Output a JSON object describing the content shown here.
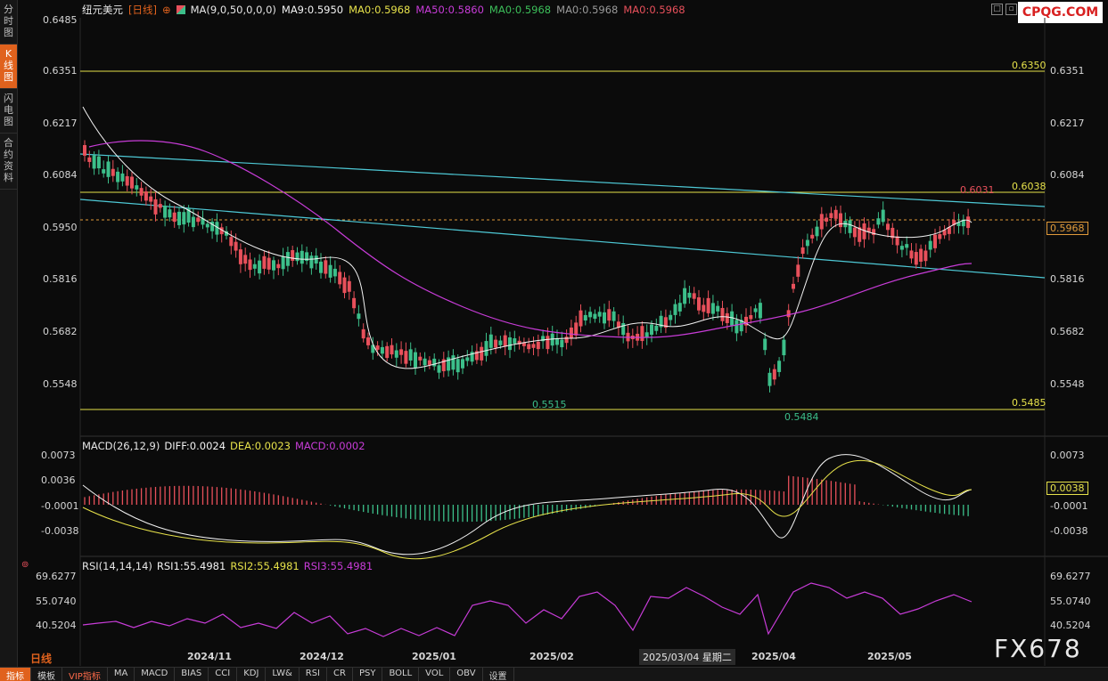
{
  "sidebar": {
    "tabs": [
      {
        "chars": [
          "分",
          "时",
          "图"
        ],
        "active": false
      },
      {
        "chars": [
          "K",
          "线",
          "图"
        ],
        "active": true
      },
      {
        "chars": [
          "闪",
          "电",
          "图"
        ],
        "active": false
      },
      {
        "chars": [
          "合",
          "约",
          "资",
          "料"
        ],
        "active": false
      }
    ]
  },
  "brand": "CPQG.COM",
  "header": {
    "symbol": "纽元美元",
    "period": "[日线]",
    "ma_params": "MA(9,0,50,0,0,0)",
    "ma9": "MA9:0.5950",
    "ma0_1": "MA0:0.5968",
    "ma50": "MA50:0.5860",
    "ma0_2": "MA0:0.5968",
    "ma0_3": "MA0:0.5968",
    "ma0_4": "MA0:0.5968"
  },
  "price_axis": [
    "0.6485",
    "0.6351",
    "0.6217",
    "0.6084",
    "0.5950",
    "0.5816",
    "0.5682",
    "0.5548"
  ],
  "levels": {
    "top": "0.6350",
    "mid": "0.6038",
    "bottom": "0.5485",
    "current": "0.5968"
  },
  "annotations": {
    "high": "0.6031",
    "low1": "0.5515",
    "low2": "0.5484"
  },
  "macd": {
    "title": "MACD(26,12,9)",
    "diff": "DIFF:0.0024",
    "dea": "DEA:0.0023",
    "macd": "MACD:0.0002",
    "axis": [
      "0.0073",
      "0.0036",
      "-0.0001",
      "-0.0038"
    ],
    "current": "0.0038"
  },
  "rsi": {
    "title": "RSI(14,14,14)",
    "rsi1": "RSI1:55.4981",
    "rsi2": "RSI2:55.4981",
    "rsi3": "RSI3:55.4981",
    "axis": [
      "69.6277",
      "55.0740",
      "40.5204"
    ]
  },
  "xaxis": [
    "2024/11",
    "2024/12",
    "2025/01",
    "2025/02",
    "2025/04",
    "2025/05"
  ],
  "crosshair_date": "2025/03/04 星期二",
  "period_label": "日线",
  "watermark": "FX678",
  "bottom_tabs": [
    "指标",
    "模板",
    "VIP指标",
    "MA",
    "MACD",
    "BIAS",
    "CCI",
    "KDJ",
    "LW&",
    "RSI",
    "CR",
    "PSY",
    "BOLL",
    "VOL",
    "OBV",
    "设置"
  ],
  "colors": {
    "up": "#e8505b",
    "down": "#3cbf8a",
    "ma9": "#f2f2f2",
    "ma50": "#c83cd8",
    "level": "#e6e14a",
    "trend": "#4ec9d6",
    "dea": "#e6e14a",
    "rsi": "#c83cd8"
  }
}
